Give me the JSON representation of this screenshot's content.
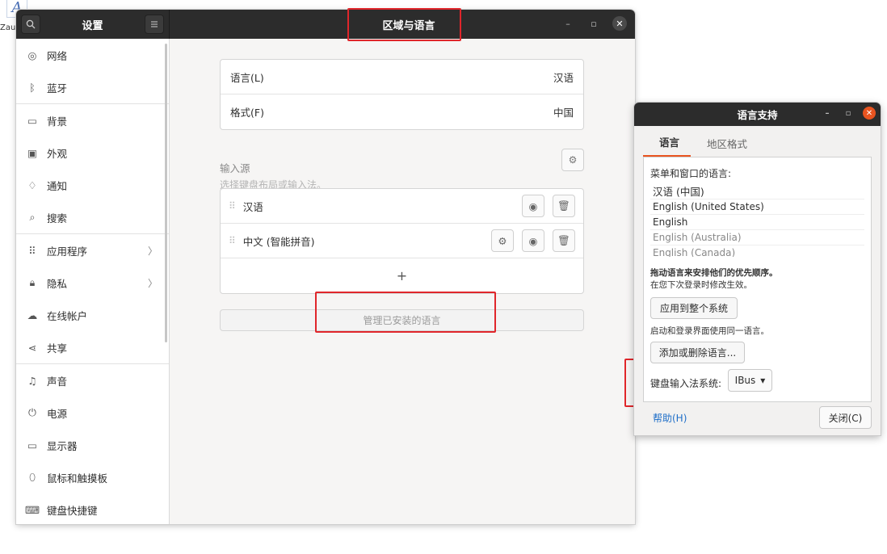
{
  "desktop": {
    "icon_glyph": "A",
    "label": "Zautl"
  },
  "settings": {
    "app_title": "设置",
    "window_title": "区域与语言",
    "sidebar": [
      {
        "label": "网络",
        "icon": "network-icon",
        "chevron": false
      },
      {
        "label": "蓝牙",
        "icon": "bluetooth-icon",
        "chevron": false
      },
      {
        "label": "背景",
        "icon": "background-icon",
        "chevron": false
      },
      {
        "label": "外观",
        "icon": "appearance-icon",
        "chevron": false
      },
      {
        "label": "通知",
        "icon": "bell-icon",
        "chevron": false
      },
      {
        "label": "搜索",
        "icon": "search-icon",
        "chevron": false
      },
      {
        "label": "应用程序",
        "icon": "apps-icon",
        "chevron": true
      },
      {
        "label": "隐私",
        "icon": "lock-icon",
        "chevron": true
      },
      {
        "label": "在线帐户",
        "icon": "cloud-icon",
        "chevron": false
      },
      {
        "label": "共享",
        "icon": "share-icon",
        "chevron": false
      },
      {
        "label": "声音",
        "icon": "music-icon",
        "chevron": false
      },
      {
        "label": "电源",
        "icon": "power-icon",
        "chevron": false
      },
      {
        "label": "显示器",
        "icon": "display-icon",
        "chevron": false
      },
      {
        "label": "鼠标和触摸板",
        "icon": "mouse-icon",
        "chevron": false
      },
      {
        "label": "键盘快捷键",
        "icon": "keyboard-icon",
        "chevron": false
      }
    ],
    "language_label": "语言(L)",
    "language_value": "汉语",
    "format_label": "格式(F)",
    "format_value": "中国",
    "input_sources_title": "输入源",
    "input_sources_hint": "选择键盘布局或输入法。",
    "input_sources": [
      "汉语",
      "中文 (智能拼音)"
    ],
    "add_symbol": "+",
    "manage_button": "管理已安装的语言"
  },
  "dialog": {
    "title": "语言支持",
    "tabs": [
      "语言",
      "地区格式"
    ],
    "menu_lang_label": "菜单和窗口的语言:",
    "languages": [
      "汉语 (中国)",
      "English (United States)",
      "English",
      "English (Australia)",
      "English (Canada)"
    ],
    "drag_hint": "拖动语言来安排他们的优先顺序。",
    "next_login_hint": "在您下次登录时修改生效。",
    "apply_button": "应用到整个系统",
    "login_screen_hint": "启动和登录界面使用同一语言。",
    "add_remove_button": "添加或删除语言...",
    "keyboard_input_label": "键盘输入法系统:",
    "keyboard_input_value": "IBus",
    "help_link": "帮助(H)",
    "close_button": "关闭(C)"
  },
  "colors": {
    "accent": "#e95420",
    "highlight": "#e0262b",
    "headerbar": "#2c2c2c",
    "link": "#1e6ec8"
  }
}
